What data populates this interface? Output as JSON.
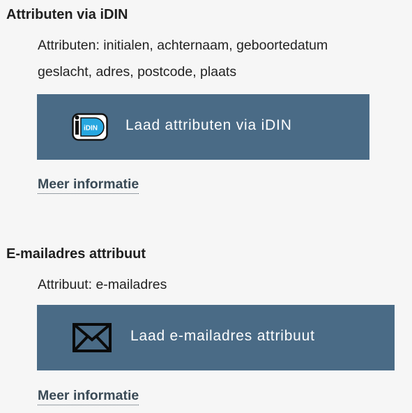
{
  "sections": [
    {
      "title": "Attributen via iDIN",
      "description_lines": [
        "Attributen: initialen, achternaam, geboortedatum",
        "geslacht, adres, postcode, plaats"
      ],
      "button_label": "Laad attributen via iDIN",
      "button_icon": "idin-logo-icon",
      "more_link": "Meer informatie"
    },
    {
      "title": "E-mailadres attribuut",
      "description_lines": [
        "Attribuut: e-mailadres"
      ],
      "button_label": "Laad e-mailadres attribuut",
      "button_icon": "envelope-icon",
      "more_link": "Meer informatie"
    }
  ],
  "icons": {
    "idin_logo_text": "iDIN"
  },
  "colors": {
    "button_background": "#4a6b86",
    "button_text": "#ffffff",
    "link_text": "#3a4a56",
    "page_background": "#f6f6f6",
    "idin_blue": "#27a7e0"
  }
}
